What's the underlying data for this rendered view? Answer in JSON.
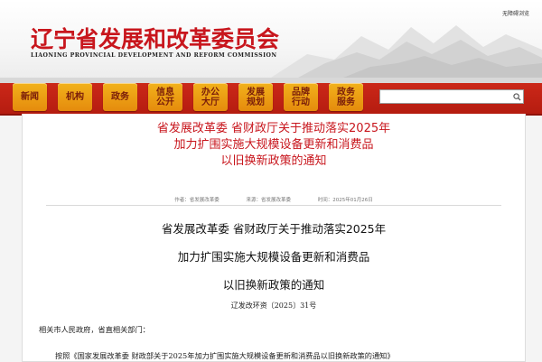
{
  "header": {
    "accessibility_link": "无障碍浏览",
    "site_title": "辽宁省发展和改革委员会",
    "site_subtitle": "LIAONING PROVINCIAL DEVELOPMENT AND REFORM COMMISSION"
  },
  "nav": {
    "items": [
      {
        "line1": "新闻",
        "line2": ""
      },
      {
        "line1": "机构",
        "line2": ""
      },
      {
        "line1": "政务",
        "line2": ""
      },
      {
        "line1": "信息",
        "line2": "公开"
      },
      {
        "line1": "办公",
        "line2": "大厅"
      },
      {
        "line1": "发展",
        "line2": "规划"
      },
      {
        "line1": "品牌",
        "line2": "行动"
      },
      {
        "line1": "政务",
        "line2": "服务"
      }
    ],
    "search_placeholder": "",
    "search_icon": "magnifier-icon"
  },
  "article": {
    "title_line1": "省发展改革委 省财政厅关于推动落实2025年",
    "title_line2": "加力扩围实施大规模设备更新和消费品",
    "title_line3": "以旧换新政策的通知",
    "author": "作者：省发展改革委",
    "source": "来源：省发展改革委",
    "date": "时间：2025年01月26日"
  },
  "document": {
    "title_line1": "省发展改革委 省财政厅关于推动落实2025年",
    "title_line2": "加力扩围实施大规模设备更新和消费品",
    "title_line3": "以旧换新政策的通知",
    "doc_number": "辽发改环资〔2025〕31号",
    "salutation": "相关市人民政府，省直相关部门：",
    "first_paragraph": "按照《国家发展改革委 财政部关于2025年加力扩围实施大规模设备更新和消费品以旧换新政策的通知》"
  },
  "colors": {
    "brand_red": "#c8161d",
    "nav_red": "#b51c10",
    "nav_button_orange": "#f2b21b"
  }
}
